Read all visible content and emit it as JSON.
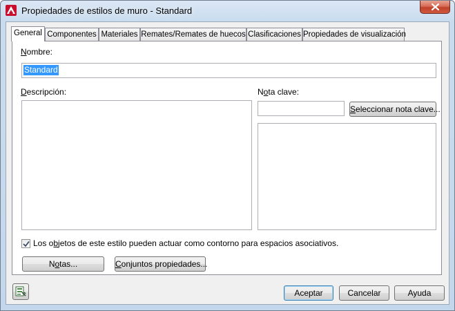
{
  "window": {
    "title": "Propiedades de estilos de muro - Standard"
  },
  "tabs": [
    {
      "label": "General",
      "active": true
    },
    {
      "label": "Componentes",
      "active": false
    },
    {
      "label": "Materiales",
      "active": false
    },
    {
      "label": "Remates/Remates de huecos",
      "active": false
    },
    {
      "label": "Clasificaciones",
      "active": false
    },
    {
      "label": "Propiedades de visualización",
      "active": false
    }
  ],
  "general": {
    "name_label_first": "N",
    "name_label_rest": "ombre:",
    "name_value": "Standard",
    "description_label_first": "D",
    "description_label_rest": "escripción:",
    "description_value": "",
    "keynote_label_start": "N",
    "keynote_label_ul": "o",
    "keynote_label_rest": "ta clave:",
    "keynote_value": "",
    "keynote_button_first": "S",
    "keynote_button_rest": "eleccionar nota clave...",
    "checkbox_label_start": "Los o",
    "checkbox_label_ul": "b",
    "checkbox_label_rest": "jetos de este estilo pueden actuar como contorno para espacios asociativos.",
    "checkbox_checked": true,
    "notes_button_start": "N",
    "notes_button_ul": "o",
    "notes_button_rest": "tas...",
    "propsets_button_first": "C",
    "propsets_button_rest": "onjuntos propiedades..."
  },
  "footer": {
    "accept": "Aceptar",
    "cancel": "Cancelar",
    "help": "Ayuda"
  },
  "colors": {
    "selection": "#3399ff",
    "close": "#c0412b",
    "app_icon": "#c8102e"
  }
}
